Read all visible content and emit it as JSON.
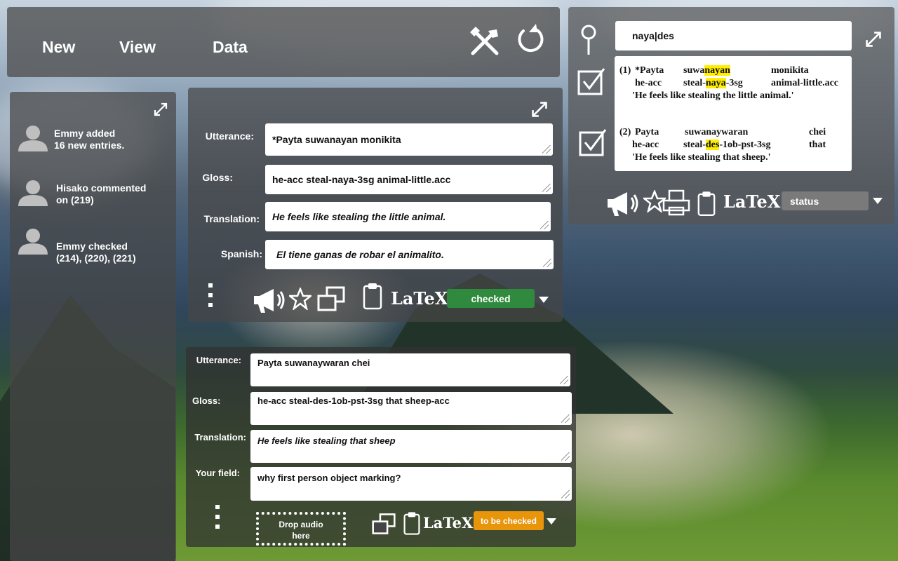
{
  "nav": {
    "new_label": "New",
    "view_label": "View",
    "data_label": "Data"
  },
  "activity": [
    {
      "line1": "Emmy added",
      "line2": "16 new entries."
    },
    {
      "line1": "Hisako commented",
      "line2": "on (219)"
    },
    {
      "line1": "Emmy checked",
      "line2": "(214), (220), (221)"
    }
  ],
  "entry1": {
    "utterance_label": "Utterance:",
    "utterance": "*Payta suwanayan monikita",
    "gloss_label": "Gloss:",
    "gloss": "he-acc steal-naya-3sg animal-little.acc",
    "translation_label": "Translation:",
    "translation": "He feels like stealing the little animal.",
    "spanish_label": "Spanish:",
    "spanish": "El tiene ganas de robar el animalito.",
    "latex_label": "LaTeX",
    "status": "checked",
    "status_color": "#2f8a3e"
  },
  "entry2": {
    "utterance_label": "Utterance:",
    "utterance": "Payta suwanaywaran chei",
    "gloss_label": "Gloss:",
    "gloss": "he-acc steal-des-1ob-pst-3sg that sheep-acc",
    "translation_label": "Translation:",
    "translation": "He feels like stealing that sheep",
    "custom_label": "Your field:",
    "custom": "why first person object marking?",
    "drop_audio_line1": "Drop audio",
    "drop_audio_line2": "here",
    "latex_label": "LaTeX",
    "status": "to be checked",
    "status_color": "#e8950c"
  },
  "search": {
    "query": "naya|des",
    "latex_label": "LaTeX",
    "status_placeholder": "status",
    "results": [
      {
        "num": "(1)",
        "words": [
          "*Payta",
          "suwanayan",
          "monikita"
        ],
        "gloss": [
          "he-acc",
          "steal-naya-3sg",
          "animal-little.acc"
        ],
        "translation": "'He feels like stealing the little animal.'"
      },
      {
        "num": "(2)",
        "words": [
          "Payta",
          "suwanaywaran",
          "chei"
        ],
        "gloss": [
          "he-acc",
          "steal-des-1ob-pst-3sg",
          "that"
        ],
        "translation": "'He feels like stealing that sheep.'"
      }
    ]
  },
  "colors": {
    "highlight": "#ffee00",
    "checked": "#2f8a3e",
    "to_be_checked": "#e8950c"
  }
}
